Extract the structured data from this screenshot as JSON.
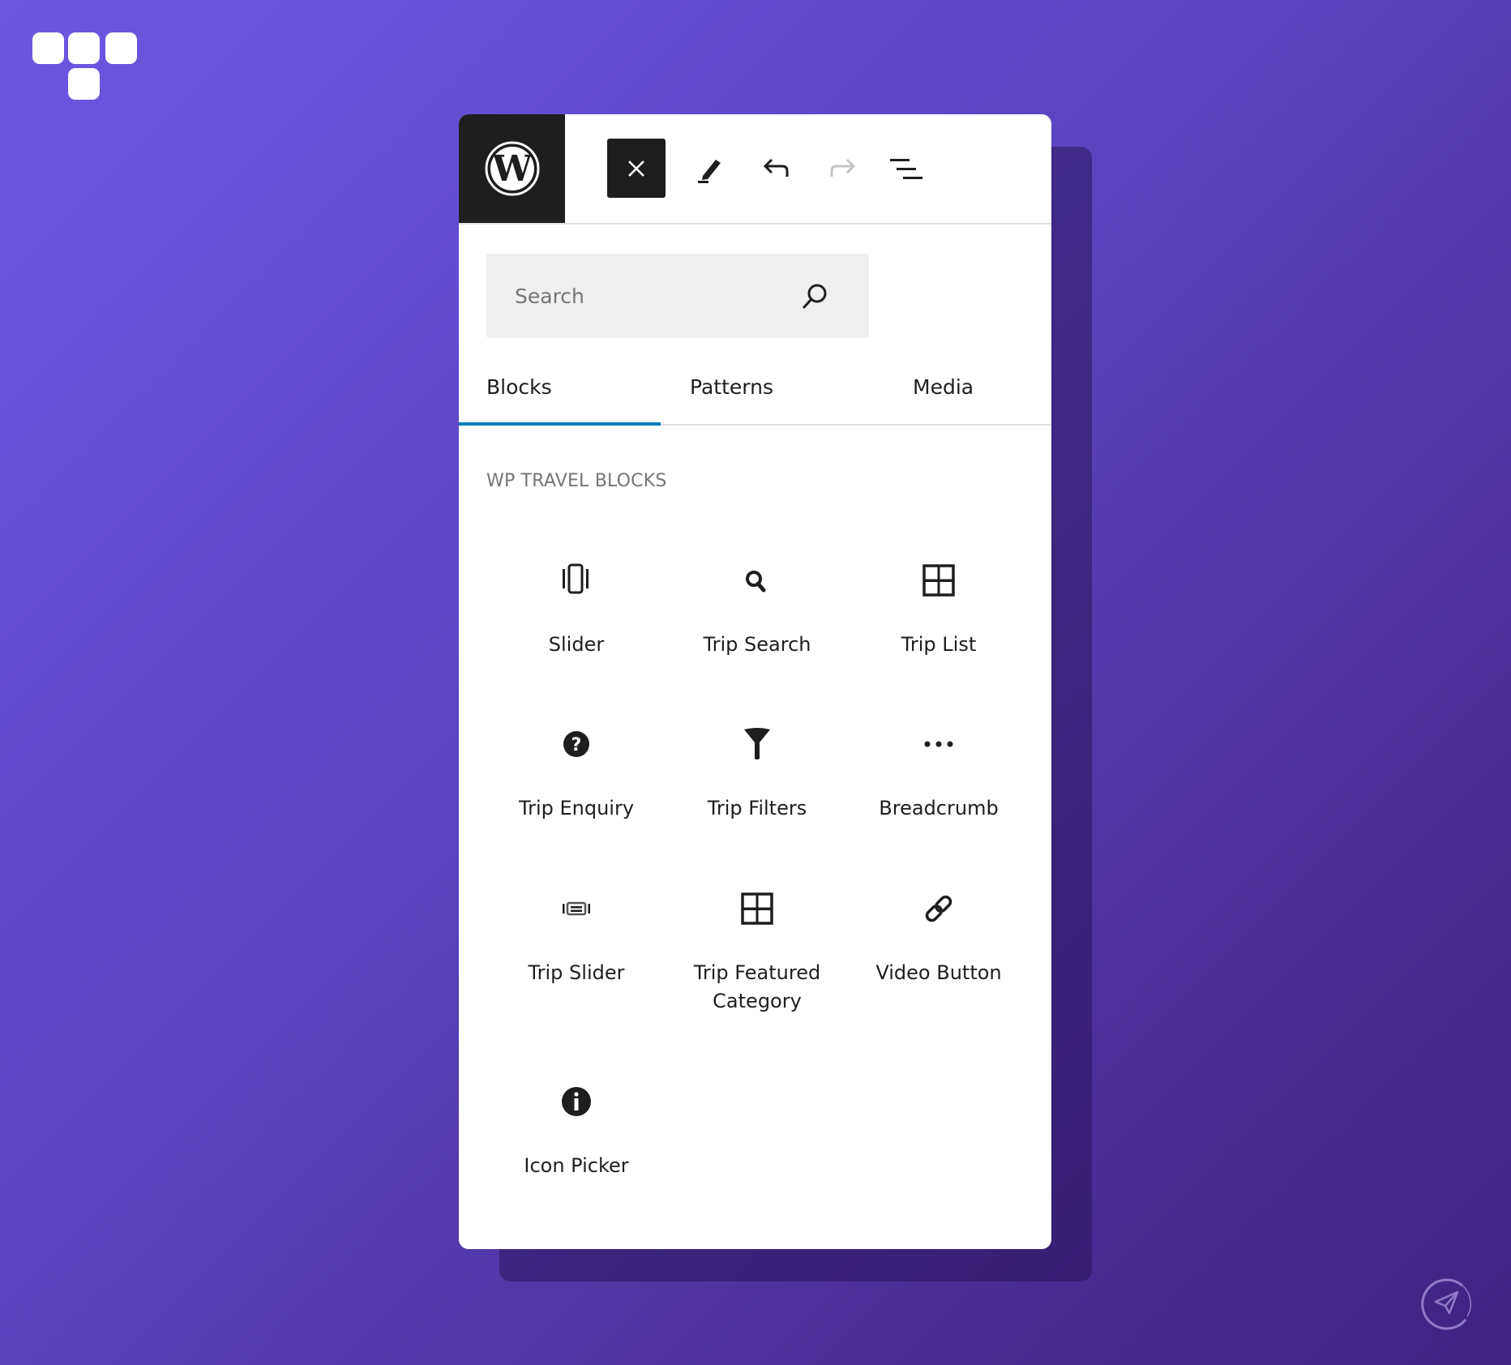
{
  "brand": {
    "logo": "brand-logo",
    "accent": "#007cba"
  },
  "header": {
    "wp_logo": "wordpress-logo-icon",
    "tools": [
      {
        "name": "close",
        "label": "Close block inserter",
        "icon": "close-icon",
        "state": "active"
      },
      {
        "name": "edit",
        "label": "Tools",
        "icon": "pencil-icon",
        "state": "enabled"
      },
      {
        "name": "undo",
        "label": "Undo",
        "icon": "undo-icon",
        "state": "enabled"
      },
      {
        "name": "redo",
        "label": "Redo",
        "icon": "redo-icon",
        "state": "disabled"
      },
      {
        "name": "list-view",
        "label": "Document overview",
        "icon": "list-view-icon",
        "state": "enabled"
      }
    ]
  },
  "search": {
    "placeholder": "Search",
    "value": ""
  },
  "tabs": [
    {
      "label": "Blocks",
      "active": true
    },
    {
      "label": "Patterns",
      "active": false
    },
    {
      "label": "Media",
      "active": false
    }
  ],
  "section": {
    "title": "WP TRAVEL BLOCKS",
    "blocks": [
      {
        "label": "Slider",
        "icon": "slider-icon"
      },
      {
        "label": "Trip Search",
        "icon": "search-icon"
      },
      {
        "label": "Trip List",
        "icon": "grid-icon"
      },
      {
        "label": "Trip Enquiry",
        "icon": "question-icon"
      },
      {
        "label": "Trip Filters",
        "icon": "filter-icon"
      },
      {
        "label": "Breadcrumb",
        "icon": "ellipsis-icon"
      },
      {
        "label": "Trip Slider",
        "icon": "gallery-slider-icon"
      },
      {
        "label": "Trip Featured Category",
        "icon": "grid-icon"
      },
      {
        "label": "Video Button",
        "icon": "link-icon"
      },
      {
        "label": "Icon Picker",
        "icon": "info-icon"
      }
    ]
  },
  "footer_badge": {
    "icon": "telegram-icon"
  }
}
